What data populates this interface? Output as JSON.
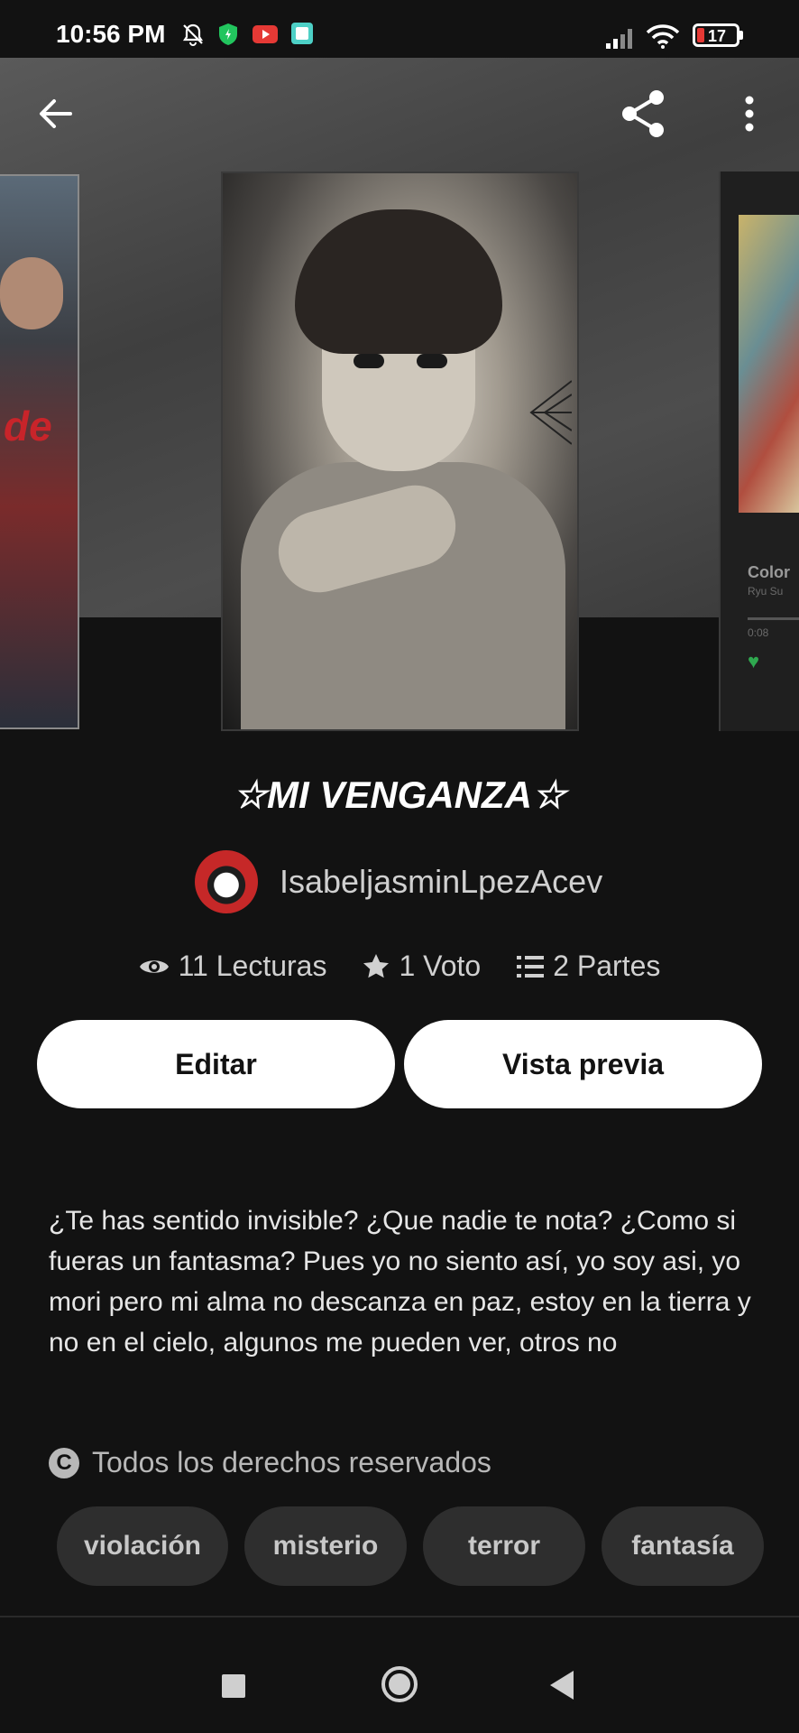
{
  "status_bar": {
    "time": "10:56 PM",
    "battery": "17",
    "icons": [
      "bell-off-icon",
      "shield-icon",
      "youtube-icon",
      "gallery-icon",
      "signal-icon",
      "wifi-icon",
      "battery-icon"
    ]
  },
  "header": {
    "back_icon": "arrow-left-icon",
    "share_icon": "share-icon",
    "more_icon": "more-vert-icon"
  },
  "covers": {
    "right_preview_title": "Color",
    "right_preview_subtitle": "Ryu Su",
    "right_preview_time": "0:08"
  },
  "story": {
    "title": "☆MI VENGANZA☆",
    "author": "IsabeljasminLpezAcev",
    "reads": "11 Lecturas",
    "votes": "1 Voto",
    "parts": "2 Partes",
    "description": "¿Te has sentido invisible? ¿Que nadie te nota? ¿Como si fueras un fantasma? Pues yo no siento así, yo soy asi, yo mori pero mi alma no descanza en paz, estoy en la tierra y no en el cielo, algunos me pueden ver, otros no",
    "rights": "Todos los derechos reservados",
    "tags": [
      "violación",
      "misterio",
      "terror",
      "fantasía"
    ]
  },
  "actions": {
    "edit_label": "Editar",
    "preview_label": "Vista previa"
  },
  "colors": {
    "background": "#121212",
    "button": "#ffffff",
    "tag_bg": "#2e2e2e",
    "battery_low": "#e53935"
  }
}
